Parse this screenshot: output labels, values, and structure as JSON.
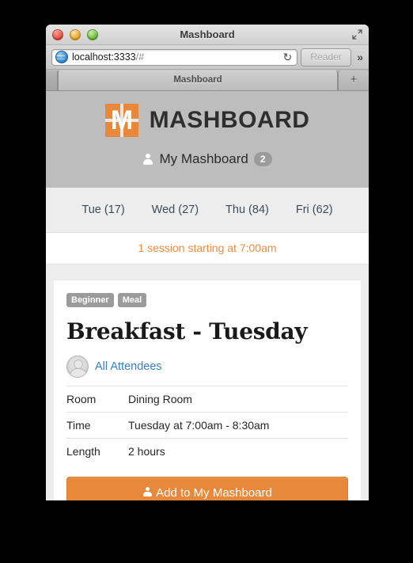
{
  "window": {
    "title": "Mashboard",
    "traffic_lights": [
      "close",
      "minimize",
      "zoom"
    ],
    "fullscreen_icon": "fullscreen-icon"
  },
  "toolbar": {
    "url_main": "localhost:3333",
    "url_fragment": "/#",
    "reload_icon": "↻",
    "reader_label": "Reader",
    "chevrons_label": "»",
    "globe_icon": "globe-icon"
  },
  "tabs": {
    "active_tab_label": "Mashboard",
    "new_tab_label": "+"
  },
  "site": {
    "brand_name": "MASHBOARD",
    "logo_letter": "M",
    "my_mashboard_label": "My Mashboard",
    "my_mashboard_count": "2"
  },
  "day_tabs": [
    {
      "label": "Tue (17)"
    },
    {
      "label": "Wed (27)"
    },
    {
      "label": "Thu (84)"
    },
    {
      "label": "Fri (62)"
    }
  ],
  "notice": {
    "text": "1 session starting at 7:00am"
  },
  "session": {
    "badges": [
      "Beginner",
      "Meal"
    ],
    "title": "Breakfast - Tuesday",
    "attendees_link": "All Attendees",
    "details": [
      {
        "key": "Room",
        "value": "Dining Room"
      },
      {
        "key": "Time",
        "value": "Tuesday at 7:00am - 8:30am"
      },
      {
        "key": "Length",
        "value": "2 hours"
      }
    ],
    "add_button_label": "Add to My Mashboard"
  },
  "colors": {
    "brand_orange": "#e8883a",
    "link_blue": "#3a7fbe",
    "badge_gray": "#9b9b9b",
    "header_gray": "#bdbdbd",
    "page_gray": "#ededed"
  }
}
